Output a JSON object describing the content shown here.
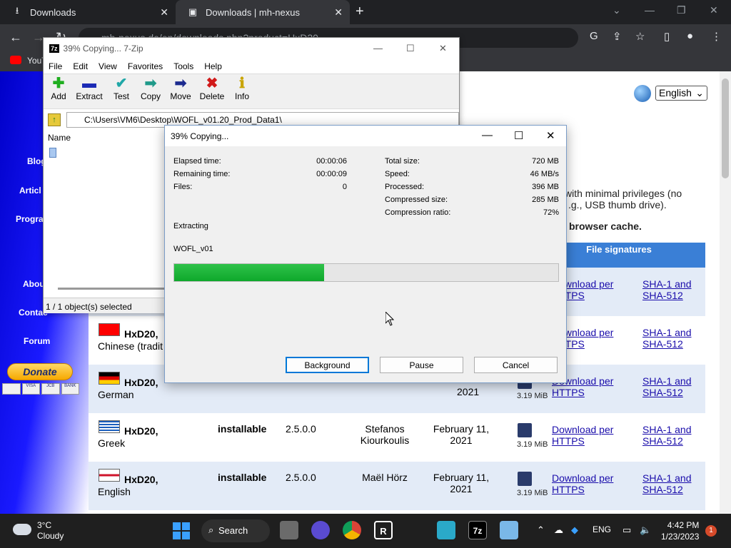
{
  "browser": {
    "tabs": [
      {
        "title": "Downloads",
        "icon": "download-icon"
      },
      {
        "title": "Downloads | mh-nexus",
        "icon": "site-icon"
      }
    ],
    "url": "mh-nexus.de/en/downloads.php?product=HxD20",
    "bookmark": "YouT"
  },
  "site": {
    "nav": [
      "Blog",
      "Articl",
      "Progra",
      "Abou",
      "Contac",
      "Forum"
    ],
    "donate": "Donate",
    "cards": [
      "VISA",
      "JCB",
      "BANK"
    ],
    "language": "English",
    "text1": "with minimal privileges (no",
    "text2": ".g., USB thumb drive).",
    "text3": "browser cache.",
    "col_file_signatures": "File signatures",
    "rows": [
      {
        "name": "HxD20,",
        "lang": "Chinese (tradit",
        "type": "",
        "version": "",
        "author": "",
        "date": "",
        "size": "",
        "download": "Download per HTTPS",
        "sig": "SHA-1 and SHA-512"
      },
      {
        "name": "HxD20,",
        "lang": "German",
        "type": "",
        "version": "",
        "author": "",
        "date": "2021",
        "size": "3.19 MiB",
        "download": "Download per HTTPS",
        "sig": "SHA-1 and SHA-512"
      },
      {
        "name": "HxD20,",
        "lang": "Greek",
        "type": "installable",
        "version": "2.5.0.0",
        "author": "Stefanos Kiourkoulis",
        "date": "February 11, 2021",
        "size": "3.19 MiB",
        "download": "Download per HTTPS",
        "sig": "SHA-1 and SHA-512"
      },
      {
        "name": "HxD20,",
        "lang": "English",
        "type": "installable",
        "version": "2.5.0.0",
        "author": "Maël Hörz",
        "date": "February 11, 2021",
        "size": "3.19 MiB",
        "download": "Download per HTTPS",
        "sig": "SHA-1 and SHA-512"
      }
    ],
    "row0_download": "Download per HTTPS",
    "row0_sig": "SHA-1 and SHA-512"
  },
  "fm": {
    "title": "39% Copying... 7-Zip",
    "logo": "7z",
    "menu": [
      "File",
      "Edit",
      "View",
      "Favorites",
      "Tools",
      "Help"
    ],
    "toolbar": [
      "Add",
      "Extract",
      "Test",
      "Copy",
      "Move",
      "Delete",
      "Info"
    ],
    "path": "C:\\Users\\VM6\\Desktop\\WOFL_v01.20_Prod_Data1\\",
    "col_name": "Name",
    "status": "1 / 1 object(s) selected"
  },
  "dialog": {
    "title": "39% Copying...",
    "elapsed_label": "Elapsed time:",
    "elapsed": "00:00:06",
    "remaining_label": "Remaining time:",
    "remaining": "00:00:09",
    "files_label": "Files:",
    "files": "0",
    "total_label": "Total size:",
    "total": "720 MB",
    "speed_label": "Speed:",
    "speed": "46 MB/s",
    "processed_label": "Processed:",
    "processed": "396 MB",
    "compressed_label": "Compressed size:",
    "compressed": "285 MB",
    "ratio_label": "Compression ratio:",
    "ratio": "72%",
    "operation": "Extracting",
    "current_file": "WOFL_v01",
    "progress": 0.39,
    "buttons": {
      "background": "Background",
      "pause": "Pause",
      "cancel": "Cancel"
    }
  },
  "taskbar": {
    "temp": "3°C",
    "condition": "Cloudy",
    "search": "Search",
    "lang": "ENG",
    "time": "4:42 PM",
    "date": "1/23/2023",
    "notifications": "1",
    "sevenzip": "7z"
  },
  "colors": {
    "progress": "#0ea82b",
    "table_header": "#3a7fd6",
    "nav_blue": "#0000c8"
  }
}
